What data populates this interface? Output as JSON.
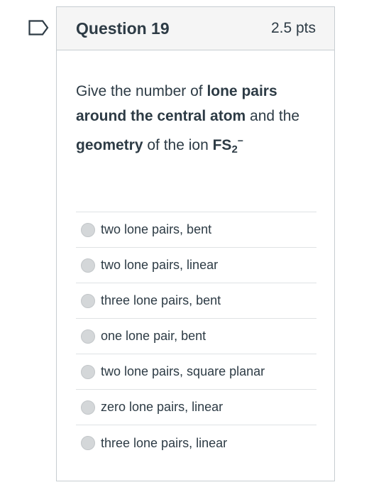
{
  "question": {
    "title": "Question 19",
    "points": "2.5 pts",
    "text_part1": "Give the number of ",
    "text_bold1": "lone pairs around the central atom",
    "text_part2": " and the ",
    "text_bold2": "geometry",
    "text_part3": " of the ion ",
    "formula_main": "FS",
    "formula_sub": "2",
    "formula_sup": "−"
  },
  "answers": [
    {
      "label": "two lone pairs, bent"
    },
    {
      "label": "two lone pairs, linear"
    },
    {
      "label": "three lone pairs, bent"
    },
    {
      "label": "one lone pair, bent"
    },
    {
      "label": "two lone pairs, square planar"
    },
    {
      "label": "zero lone pairs, linear"
    },
    {
      "label": "three lone pairs, linear"
    }
  ],
  "icons": {
    "flag": "flag-question-icon"
  },
  "colors": {
    "text": "#2d3b45",
    "border": "#c7cdd1",
    "header_bg": "#f5f5f5",
    "flag": "#2d3b45"
  }
}
